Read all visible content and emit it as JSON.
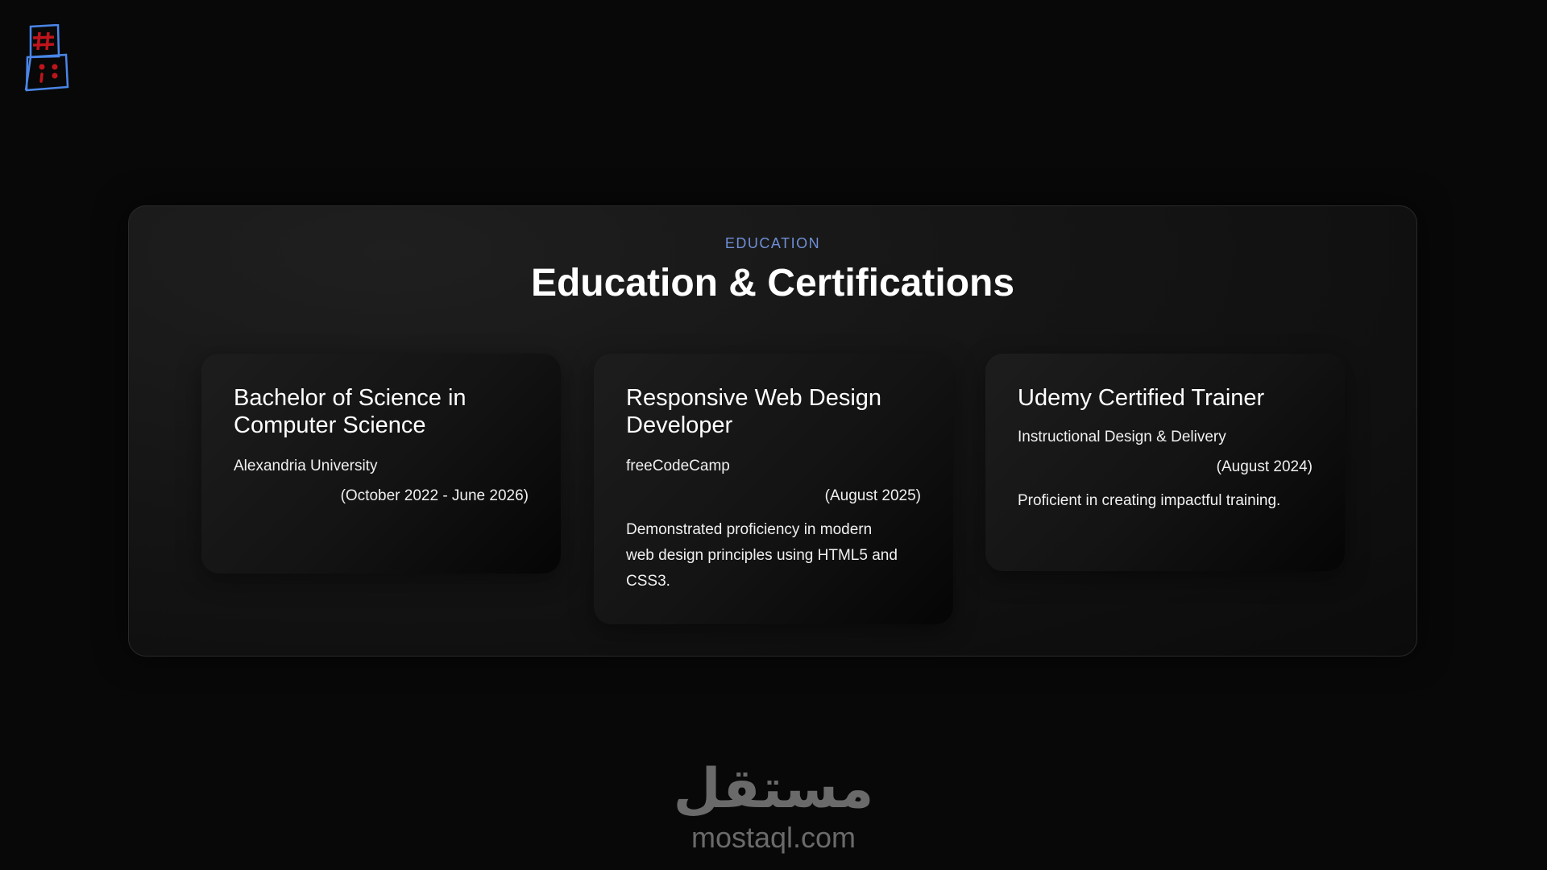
{
  "header": {
    "logo_icon": "hash-semicolon-logo-icon"
  },
  "section": {
    "eyebrow": "EDUCATION",
    "title": "Education & Certifications"
  },
  "cards": [
    {
      "title": "Bachelor of Science in Computer Science",
      "organization": "Alexandria University",
      "date": "(October 2022 - June 2026)",
      "description": ""
    },
    {
      "title": "Responsive Web Design Developer",
      "organization": "freeCodeCamp",
      "date": "(August 2025)",
      "description": "Demonstrated proficiency in modern web design principles using HTML5 and CSS3."
    },
    {
      "title": "Udemy Certified Trainer",
      "organization": "Instructional Design & Delivery",
      "date": "(August 2024)",
      "description": "Proficient in creating impactful training."
    }
  ],
  "watermark": {
    "arabic": "مستقل",
    "latin": "mostaql.com"
  },
  "colors": {
    "accent": "#6f8fd6",
    "background": "#080808",
    "logo_outline": "#4a86e8",
    "logo_mark": "#c0141c"
  }
}
